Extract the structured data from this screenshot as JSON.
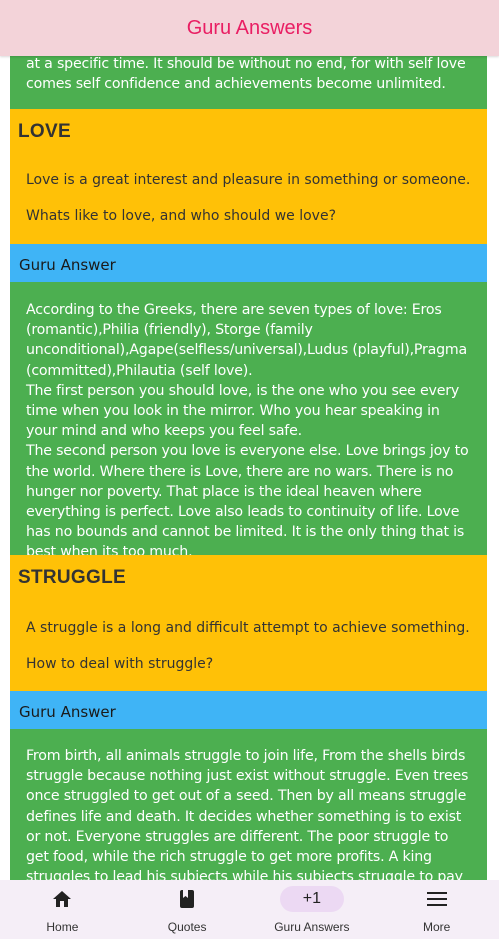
{
  "app": {
    "title": "Guru Answers"
  },
  "top_answer": {
    "text": "at a specific time. It should be without no end, for with self love comes self confidence and achievements become unlimited."
  },
  "topics": [
    {
      "title": "LOVE",
      "definition": "Love is a great interest and pleasure in something or someone.",
      "question": "Whats like to love, and who should we love?",
      "guru_label": "Guru Answer",
      "answer": "According to the Greeks, there are seven types of love: Eros (romantic),Philia (friendly), Storge (family unconditional),Agape(selfless/universal),Ludus (playful),Pragma (committed),Philautia (self love).\nThe first person you should love, is the one who you see every time when you look in the mirror. Who you hear speaking in your mind and who keeps you feel safe.\nThe second person you love is everyone else. Love brings joy to the world. Where there is Love, there are no wars. There is no hunger nor poverty. That place is the ideal heaven where everything is perfect. Love also leads to continuity of life. Love has no bounds and cannot be limited. It is the only thing that is best when its too much."
    },
    {
      "title": "STRUGGLE",
      "definition": "A struggle is a long and difficult attempt to achieve something.",
      "question": "How to deal with struggle?",
      "guru_label": "Guru Answer",
      "answer": " From birth, all animals struggle to join life, From the shells birds struggle because nothing just exist without struggle. Even trees once struggled to get out of a seed. Then by all means struggle defines life and death. It decides whether something is to exist or not. Everyone struggles are different. The poor struggle to get food, while the rich struggle to get more profits. A king struggles to lead his subjects while his subjects struggle to pay taxes and serve their"
    }
  ],
  "bottom_nav": {
    "items": [
      {
        "label": "Home",
        "icon": "home-icon"
      },
      {
        "label": "Quotes",
        "icon": "book-icon"
      },
      {
        "label": "Guru Answers",
        "icon": "plus-one-icon",
        "icon_text": "+1",
        "active": true
      },
      {
        "label": "More",
        "icon": "menu-icon"
      }
    ]
  },
  "colors": {
    "appbar_bg": "#f3d3d9",
    "title": "#e91e63",
    "answer_bg": "#4caf50",
    "topic_bg": "#ffc107",
    "guru_bar_bg": "#3fb4f6",
    "nav_bg": "#f5eef7"
  }
}
